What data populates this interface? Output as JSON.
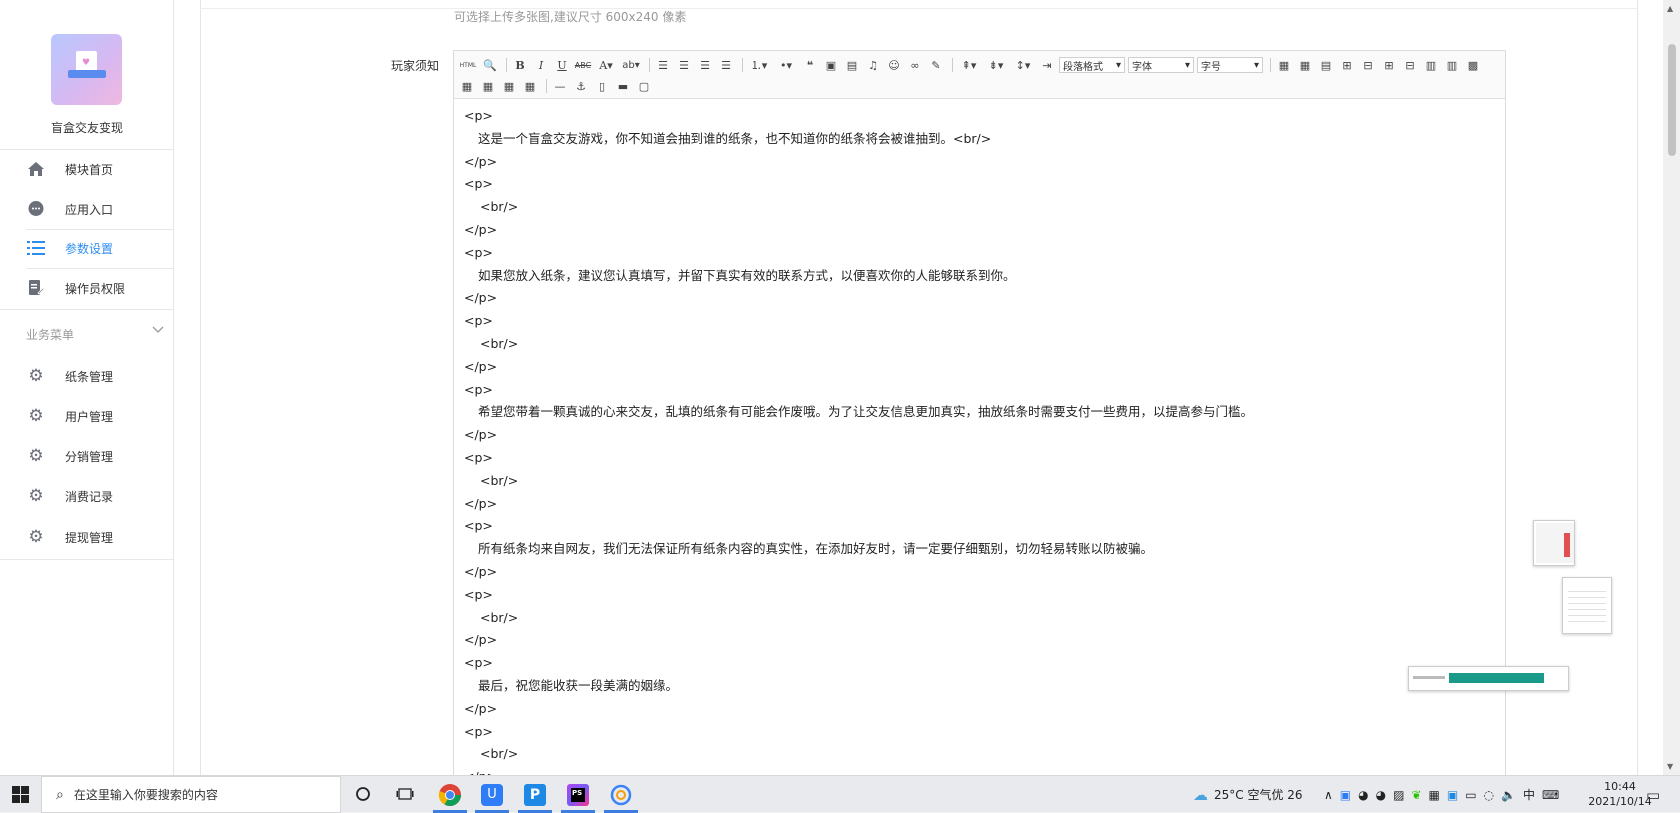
{
  "sidebar": {
    "app_name": "盲盒交友变现",
    "items": [
      {
        "label": "模块首页",
        "icon": "home-icon"
      },
      {
        "label": "应用入口",
        "icon": "chat-bubble-icon"
      },
      {
        "label": "参数设置",
        "icon": "list-icon",
        "active": true
      },
      {
        "label": "操作员权限",
        "icon": "document-edit-icon"
      }
    ],
    "group_title": "业务菜单",
    "group_items": [
      {
        "label": "纸条管理",
        "icon": "gear-icon"
      },
      {
        "label": "用户管理",
        "icon": "gear-icon"
      },
      {
        "label": "分销管理",
        "icon": "gear-icon"
      },
      {
        "label": "消费记录",
        "icon": "gear-icon"
      },
      {
        "label": "提现管理",
        "icon": "gear-icon"
      }
    ]
  },
  "main": {
    "upload_hint": "可选择上传多张图,建议尺寸 600x240 像素",
    "field_label": "玩家须知",
    "toolbar": {
      "html_label": "HTML",
      "paragraph_format": "段落格式",
      "font_family": "字体",
      "font_size": "字号"
    },
    "code_lines": [
      {
        "text": "<p>",
        "indent": 0
      },
      {
        "text": "这是一个盲盒交友游戏，你不知道会抽到谁的纸条，也不知道你的纸条将会被谁抽到。<br/>",
        "indent": 1
      },
      {
        "text": "</p>",
        "indent": 0
      },
      {
        "text": "<p>",
        "indent": 0
      },
      {
        "text": "<br/>",
        "indent": 2
      },
      {
        "text": "</p>",
        "indent": 0
      },
      {
        "text": "<p>",
        "indent": 0
      },
      {
        "text": "如果您放入纸条，建议您认真填写，并留下真实有效的联系方式，以便喜欢你的人能够联系到你。",
        "indent": 1
      },
      {
        "text": "</p>",
        "indent": 0
      },
      {
        "text": "<p>",
        "indent": 0
      },
      {
        "text": "<br/>",
        "indent": 2
      },
      {
        "text": "</p>",
        "indent": 0
      },
      {
        "text": "<p>",
        "indent": 0
      },
      {
        "text": "希望您带着一颗真诚的心来交友，乱填的纸条有可能会作废哦。为了让交友信息更加真实，抽放纸条时需要支付一些费用，以提高参与门槛。",
        "indent": 1
      },
      {
        "text": "</p>",
        "indent": 0
      },
      {
        "text": "<p>",
        "indent": 0
      },
      {
        "text": "<br/>",
        "indent": 2
      },
      {
        "text": "</p>",
        "indent": 0
      },
      {
        "text": "<p>",
        "indent": 0
      },
      {
        "text": "所有纸条均来自网友，我们无法保证所有纸条内容的真实性，在添加好友时，请一定要仔细甄别，切勿轻易转账以防被骗。",
        "indent": 1
      },
      {
        "text": "</p>",
        "indent": 0
      },
      {
        "text": "<p>",
        "indent": 0
      },
      {
        "text": "<br/>",
        "indent": 2
      },
      {
        "text": "</p>",
        "indent": 0
      },
      {
        "text": "<p>",
        "indent": 0
      },
      {
        "text": "最后，祝您能收获一段美满的姻缘。",
        "indent": 1
      },
      {
        "text": "</p>",
        "indent": 0
      },
      {
        "text": "<p>",
        "indent": 0
      },
      {
        "text": "<br/>",
        "indent": 2
      },
      {
        "text": "</p>",
        "indent": 0
      }
    ]
  },
  "taskbar": {
    "search_placeholder": "在这里输入你要搜索的内容",
    "weather": "25°C 空气优 26",
    "ime": "中",
    "time": "10:44",
    "date": "2021/10/14"
  },
  "colors": {
    "accent": "#2d8cf0",
    "sidebar_icon": "#6b6f7a",
    "taskbar_bg": "#e9eaee"
  }
}
